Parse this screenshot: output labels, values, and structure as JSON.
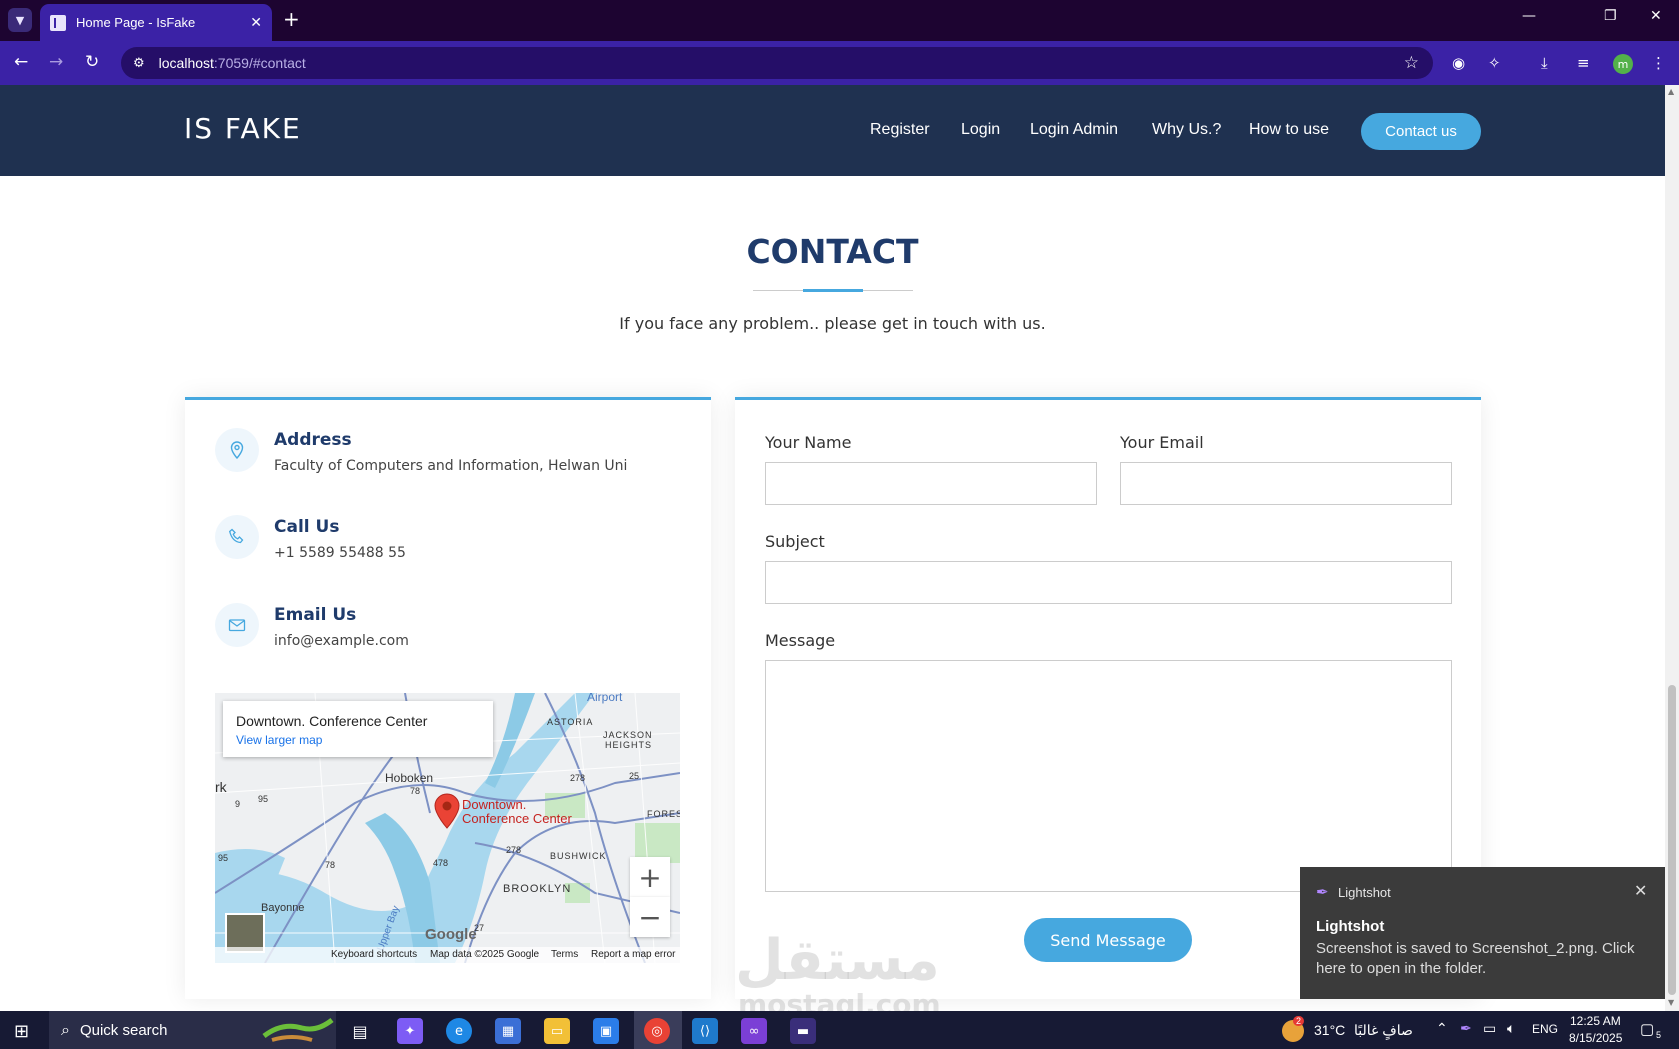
{
  "browser": {
    "tab_title": "Home Page - IsFake",
    "url_host": "localhost",
    "url_rest": ":7059/#contact",
    "avatar_initial": "m"
  },
  "header": {
    "logo": "IS FAKE",
    "nav": [
      "Register",
      "Login",
      "Login Admin",
      "Why Us.?",
      "How to use"
    ],
    "cta": "Contact us"
  },
  "contact": {
    "title": "CONTACT",
    "subtitle": "If you face any problem.. please get in touch with us.",
    "address_label": "Address",
    "address_value": "Faculty of Computers and Information, Helwan Uni",
    "call_label": "Call Us",
    "call_value": "+1 5589 55488 55",
    "email_label": "Email Us",
    "email_value": "info@example.com"
  },
  "map": {
    "place_name": "Downtown. Conference Center",
    "view_larger": "View larger map",
    "pin_label_1": "Downtown.",
    "pin_label_2": "Conference Center",
    "labels": [
      "Airport",
      "ASTORIA",
      "JACKSON",
      "HEIGHTS",
      "Hoboken",
      "rk",
      "FOREST",
      "BUSHWICK",
      "BROOKLYN",
      "Bayonne",
      "Upper Bay"
    ],
    "route_shields": [
      "9",
      "95",
      "78",
      "278",
      "25",
      "478",
      "278",
      "95",
      "78",
      "27"
    ],
    "zoom_in": "+",
    "zoom_out": "−",
    "logo": "Google",
    "footer": {
      "shortcuts": "Keyboard shortcuts",
      "data": "Map data ©2025 Google",
      "terms": "Terms",
      "report": "Report a map error"
    }
  },
  "form": {
    "name_label": "Your Name",
    "email_label": "Your Email",
    "subject_label": "Subject",
    "message_label": "Message",
    "submit": "Send Message"
  },
  "toast": {
    "app": "Lightshot",
    "heading": "Lightshot",
    "message": "Screenshot is saved to Screenshot_2.png. Click here to open in the folder."
  },
  "watermark": {
    "arabic": "مستقل",
    "latin": "mostaql.com"
  },
  "taskbar": {
    "search": "Quick search",
    "weather_badge": "2",
    "temperature": "31°C",
    "weather_text": "صافٍ غالبًا",
    "language": "ENG",
    "time": "12:25 AM",
    "date": "8/15/2025",
    "notifications": "5"
  }
}
